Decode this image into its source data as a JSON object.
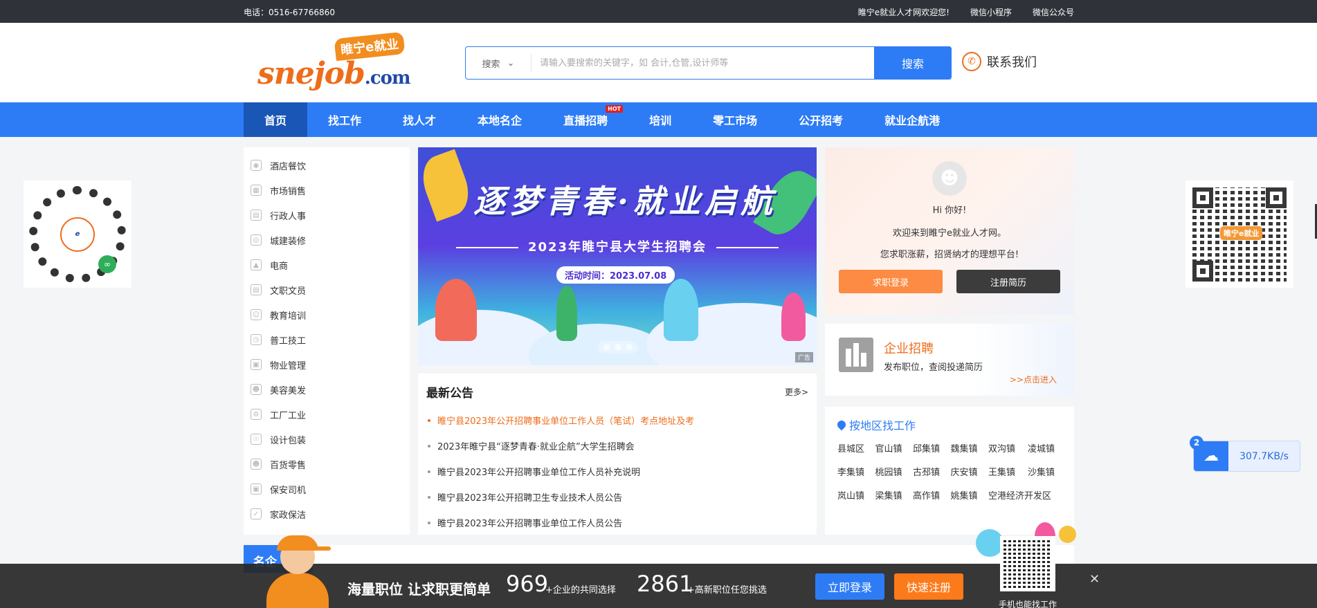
{
  "topbar": {
    "phone": "电话：0516-67766860",
    "links": [
      "睢宁e就业人才网欢迎您!",
      "微信小程序",
      "微信公众号"
    ]
  },
  "logo": {
    "badge": "睢宁e就业",
    "word": "snejob",
    "domain": ".com"
  },
  "search": {
    "select_label": "搜索",
    "placeholder": "请输入要搜索的关键字，如 会计,仓管,设计师等",
    "button": "搜索"
  },
  "contact": {
    "label": "联系我们"
  },
  "nav": {
    "items": [
      "首页",
      "找工作",
      "找人才",
      "本地名企",
      "直播招聘",
      "培训",
      "零工市场",
      "公开招考",
      "就业企航港"
    ],
    "hot_badge": "HOT"
  },
  "categories": [
    "酒店餐饮",
    "市场销售",
    "行政人事",
    "城建装修",
    "电商",
    "文职文员",
    "教育培训",
    "普工技工",
    "物业管理",
    "美容美发",
    "工厂工业",
    "设计包装",
    "百货零售",
    "保安司机",
    "家政保洁"
  ],
  "banner": {
    "title": "逐梦青春·就业启航",
    "subtitle": "2023年睢宁县大学生招聘会",
    "date": "活动时间：2023.07.08",
    "ad_tag": "广告"
  },
  "notices": {
    "title": "最新公告",
    "more": "更多>",
    "items": [
      "睢宁县2023年公开招聘事业单位工作人员（笔试）考点地址及考",
      "2023年睢宁县“逐梦青春·就业企航”大学生招聘会",
      "睢宁县2023年公开招聘事业单位工作人员补充说明",
      "睢宁县2023年公开招聘卫生专业技术人员公告",
      "睢宁县2023年公开招聘事业单位工作人员公告"
    ]
  },
  "user": {
    "greeting": "Hi 你好!",
    "line1": "欢迎来到睢宁e就业人才网。",
    "line2": "您求职涨薪，招贤纳才的理想平台!",
    "login_button": "求职登录",
    "register_button": "注册简历"
  },
  "enterprise": {
    "title": "企业招聘",
    "desc": "发布职位，查阅投递简历",
    "link": ">>点击进入"
  },
  "region": {
    "title": "按地区找工作",
    "towns": [
      "县城区",
      "官山镇",
      "邱集镇",
      "魏集镇",
      "双沟镇",
      "凌城镇",
      "李集镇",
      "桃园镇",
      "古邳镇",
      "庆安镇",
      "王集镇",
      "沙集镇",
      "岚山镇",
      "梁集镇",
      "高作镇",
      "姚集镇",
      "空港经济开发区"
    ]
  },
  "speed": {
    "badge": "2",
    "value": "307.7KB/s"
  },
  "famous": {
    "title": "名企"
  },
  "bottom": {
    "slogan": "海量职位 让求职更简单",
    "count1": "969",
    "count1_label": "+企业的共同选择",
    "count2": "2861",
    "count2_label": "+高新职位任您挑选",
    "login": "立即登录",
    "register": "快速注册",
    "qr_label": "手机也能找工作",
    "close": "✕"
  },
  "colors": {
    "brand_blue": "#2d7cf6",
    "brand_orange": "#ef6c1a",
    "dark": "#2f3239"
  }
}
